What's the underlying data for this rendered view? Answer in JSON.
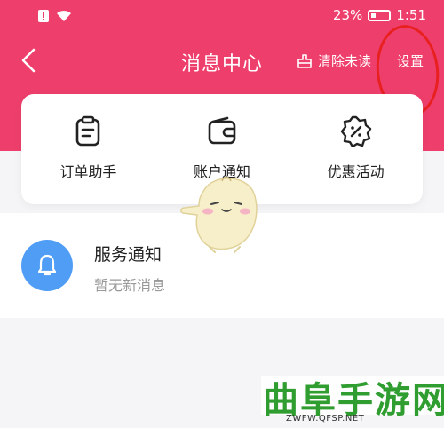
{
  "status_bar": {
    "battery": "23%",
    "time": "1:51"
  },
  "nav": {
    "title": "消息中心",
    "clear_label": "清除未读",
    "settings_label": "设置"
  },
  "quick_actions": [
    {
      "label": "订单助手",
      "icon": "clipboard-icon"
    },
    {
      "label": "账户通知",
      "icon": "wallet-icon"
    },
    {
      "label": "优惠活动",
      "icon": "discount-badge-icon"
    }
  ],
  "notifications": [
    {
      "title": "服务通知",
      "subtitle": "暂无新消息",
      "icon": "bell-icon"
    }
  ],
  "watermark": {
    "title": "曲阜手游网",
    "url": "ZWFW.QFSP.NET"
  },
  "colors": {
    "header": "#ee3f6c",
    "bell": "#4f9df5",
    "annotation": "#e82020",
    "watermark": "#2f9d2f"
  }
}
